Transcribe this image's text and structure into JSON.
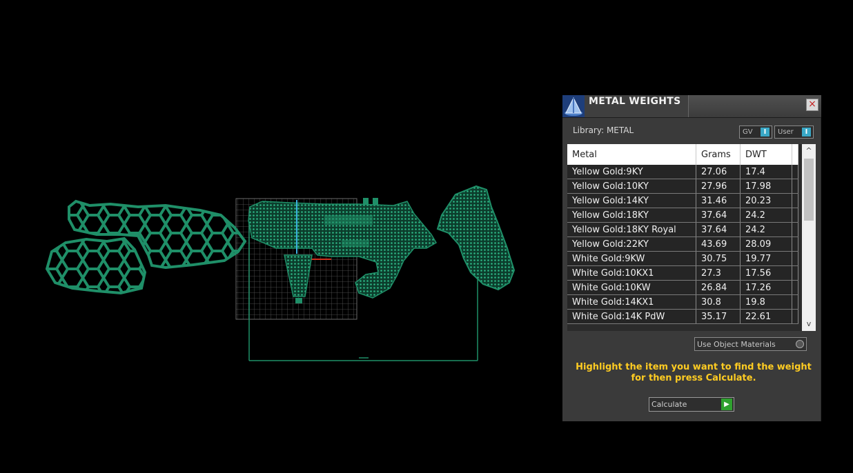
{
  "panel": {
    "title": "METAL WEIGHTS",
    "close_glyph": "×",
    "library_label": "Library: METAL",
    "toggles": [
      {
        "label": "GV",
        "indicator": "I"
      },
      {
        "label": "User",
        "indicator": "I"
      }
    ],
    "table": {
      "headers": [
        "Metal",
        "Grams",
        "DWT"
      ],
      "rows": [
        [
          "Yellow Gold:9KY",
          "27.06",
          "17.4"
        ],
        [
          "Yellow Gold:10KY",
          "27.96",
          "17.98"
        ],
        [
          "Yellow Gold:14KY",
          "31.46",
          "20.23"
        ],
        [
          "Yellow Gold:18KY",
          "37.64",
          "24.2"
        ],
        [
          "Yellow Gold:18KY Royal",
          "37.64",
          "24.2"
        ],
        [
          "Yellow Gold:22KY",
          "43.69",
          "28.09"
        ],
        [
          "White Gold:9KW",
          "30.75",
          "19.77"
        ],
        [
          "White Gold:10KX1",
          "27.3",
          "17.56"
        ],
        [
          "White Gold:10KW",
          "26.84",
          "17.26"
        ],
        [
          "White Gold:14KX1",
          "30.8",
          "19.8"
        ],
        [
          "White Gold:14K PdW",
          "35.17",
          "22.61"
        ]
      ],
      "scroll_up_glyph": "^",
      "scroll_down_glyph": "v"
    },
    "use_object_materials_label": "Use Object Materials",
    "hint_text": "Highlight the item you want to find the weight for then press Calculate.",
    "calculate_label": "Calculate",
    "calculate_glyph": "▶"
  },
  "colors": {
    "background": "#000000",
    "panel_bg": "#3a3a3a",
    "mesh": "#1f8f68",
    "hint": "#ffcc22",
    "toggle_on": "#39a8c6",
    "calculate_go": "#2fa12f"
  },
  "icons": {
    "app_icon": "cone-pyramid-icon",
    "close_icon": "close-icon",
    "calculate_icon": "play-arrow-icon"
  }
}
